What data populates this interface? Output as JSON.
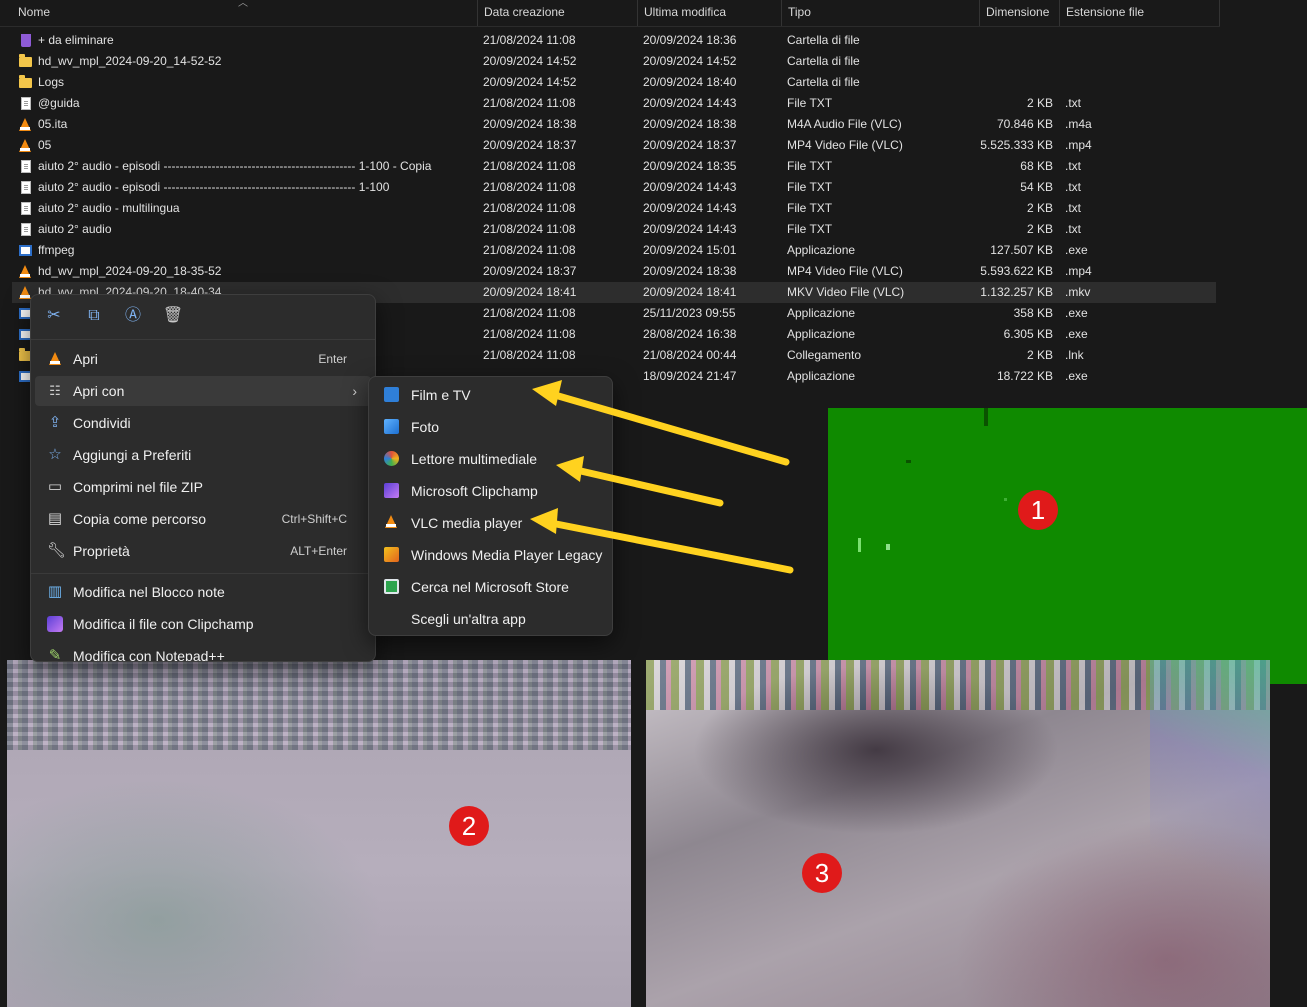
{
  "colors": {
    "background": "#191919",
    "menu_bg": "#2c2c2c",
    "arrow": "#ffd21f",
    "badge": "#e01a1a",
    "green_panel": "#0f8a00"
  },
  "columns": {
    "name": "Nome",
    "created": "Data creazione",
    "modified": "Ultima modifica",
    "type": "Tipo",
    "size": "Dimensione",
    "ext": "Estensione file"
  },
  "files": [
    {
      "icon": "recycle-bin-icon",
      "name": "+ da eliminare",
      "created": "21/08/2024 11:08",
      "modified": "20/09/2024 18:36",
      "type": "Cartella di file",
      "size": "",
      "ext": ""
    },
    {
      "icon": "folder-icon",
      "name": "hd_wv_mpl_2024-09-20_14-52-52",
      "created": "20/09/2024 14:52",
      "modified": "20/09/2024 14:52",
      "type": "Cartella di file",
      "size": "",
      "ext": ""
    },
    {
      "icon": "folder-icon",
      "name": "Logs",
      "created": "20/09/2024 14:52",
      "modified": "20/09/2024 18:40",
      "type": "Cartella di file",
      "size": "",
      "ext": ""
    },
    {
      "icon": "text-file-icon",
      "name": "@guida",
      "created": "21/08/2024 11:08",
      "modified": "20/09/2024 14:43",
      "type": "File TXT",
      "size": "2 KB",
      "ext": ".txt"
    },
    {
      "icon": "vlc-icon",
      "name": "05.ita",
      "created": "20/09/2024 18:38",
      "modified": "20/09/2024 18:38",
      "type": "M4A Audio File (VLC)",
      "size": "70.846 KB",
      "ext": ".m4a"
    },
    {
      "icon": "vlc-icon",
      "name": "05",
      "created": "20/09/2024 18:37",
      "modified": "20/09/2024 18:37",
      "type": "MP4 Video File (VLC)",
      "size": "5.525.333 KB",
      "ext": ".mp4"
    },
    {
      "icon": "text-file-icon",
      "name": "aiuto 2° audio - episodi ------------------------------------------------ 1-100 - Copia",
      "created": "21/08/2024 11:08",
      "modified": "20/09/2024 18:35",
      "type": "File TXT",
      "size": "68 KB",
      "ext": ".txt"
    },
    {
      "icon": "text-file-icon",
      "name": "aiuto 2° audio - episodi ------------------------------------------------ 1-100",
      "created": "21/08/2024 11:08",
      "modified": "20/09/2024 14:43",
      "type": "File TXT",
      "size": "54 KB",
      "ext": ".txt"
    },
    {
      "icon": "text-file-icon",
      "name": "aiuto 2° audio - multilingua",
      "created": "21/08/2024 11:08",
      "modified": "20/09/2024 14:43",
      "type": "File TXT",
      "size": "2 KB",
      "ext": ".txt"
    },
    {
      "icon": "text-file-icon",
      "name": "aiuto 2° audio",
      "created": "21/08/2024 11:08",
      "modified": "20/09/2024 14:43",
      "type": "File TXT",
      "size": "2 KB",
      "ext": ".txt"
    },
    {
      "icon": "application-icon",
      "name": "ffmpeg",
      "created": "21/08/2024 11:08",
      "modified": "20/09/2024 15:01",
      "type": "Applicazione",
      "size": "127.507 KB",
      "ext": ".exe"
    },
    {
      "icon": "vlc-icon",
      "name": "hd_wv_mpl_2024-09-20_18-35-52",
      "created": "20/09/2024 18:37",
      "modified": "20/09/2024 18:38",
      "type": "MP4 Video File (VLC)",
      "size": "5.593.622 KB",
      "ext": ".mp4"
    },
    {
      "icon": "vlc-icon",
      "name": "hd_wv_mpl_2024-09-20_18-40-34",
      "created": "20/09/2024 18:41",
      "modified": "20/09/2024 18:41",
      "type": "MKV Video File (VLC)",
      "size": "1.132.257 KB",
      "ext": ".mkv",
      "selected": true
    },
    {
      "icon": "application-icon",
      "name": "",
      "created": "21/08/2024 11:08",
      "modified": "25/11/2023 09:55",
      "type": "Applicazione",
      "size": "358 KB",
      "ext": ".exe"
    },
    {
      "icon": "application-icon",
      "name": "",
      "created": "21/08/2024 11:08",
      "modified": "28/08/2024 16:38",
      "type": "Applicazione",
      "size": "6.305 KB",
      "ext": ".exe"
    },
    {
      "icon": "shortcut-icon",
      "name": "",
      "created": "21/08/2024 11:08",
      "modified": "21/08/2024 00:44",
      "type": "Collegamento",
      "size": "2 KB",
      "ext": ".lnk"
    },
    {
      "icon": "application-icon",
      "name": "",
      "created": "",
      "modified": "18/09/2024 21:47",
      "type": "Applicazione",
      "size": "18.722 KB",
      "ext": ".exe"
    }
  ],
  "context_menu": {
    "toolbar": [
      {
        "icon": "cut-icon",
        "glyph": "✂"
      },
      {
        "icon": "copy-icon",
        "glyph": "⧉"
      },
      {
        "icon": "rename-icon",
        "glyph": "Ⓐ"
      },
      {
        "icon": "delete-icon",
        "glyph": "🗑"
      }
    ],
    "items": [
      {
        "label": "Apri",
        "shortcut": "Enter",
        "icon": "vlc-icon"
      },
      {
        "label": "Apri con",
        "shortcut": "",
        "icon": "open-with-icon",
        "submenu": true
      },
      {
        "label": "Condividi",
        "shortcut": "",
        "icon": "share-icon"
      },
      {
        "label": "Aggiungi a Preferiti",
        "shortcut": "",
        "icon": "star-icon"
      },
      {
        "label": "Comprimi nel file ZIP",
        "shortcut": "",
        "icon": "zip-icon"
      },
      {
        "label": "Copia come percorso",
        "shortcut": "Ctrl+Shift+C",
        "icon": "copy-path-icon"
      },
      {
        "label": "Proprietà",
        "shortcut": "ALT+Enter",
        "icon": "wrench-icon"
      }
    ],
    "extra_items": [
      {
        "label": "Modifica nel Blocco note",
        "icon": "notepad-icon"
      },
      {
        "label": "Modifica il file con Clipchamp",
        "icon": "clipchamp-icon"
      },
      {
        "label": "Modifica con Notepad++",
        "icon": "notepadpp-icon"
      }
    ]
  },
  "open_with_menu": [
    {
      "label": "Film e TV",
      "icon": "films-tv-icon",
      "color": "#2f7fd8"
    },
    {
      "label": "Foto",
      "icon": "photos-icon",
      "color": "#3b8fe6"
    },
    {
      "label": "Lettore multimediale",
      "icon": "media-player-icon",
      "color": "#e0513a"
    },
    {
      "label": "Microsoft Clipchamp",
      "icon": "clipchamp-icon",
      "color": "#8d5cf0"
    },
    {
      "label": "VLC media player",
      "icon": "vlc-icon",
      "color": "#f28b12"
    },
    {
      "label": "Windows Media Player Legacy",
      "icon": "wmp-icon",
      "color": "#f2a11d"
    },
    {
      "label": "Cerca nel Microsoft Store",
      "icon": "store-icon",
      "color": "#2da44e"
    },
    {
      "label": "Scegli un'altra app",
      "icon": "",
      "color": ""
    }
  ],
  "panels": [
    {
      "label": "1"
    },
    {
      "label": "2"
    },
    {
      "label": "3"
    }
  ]
}
